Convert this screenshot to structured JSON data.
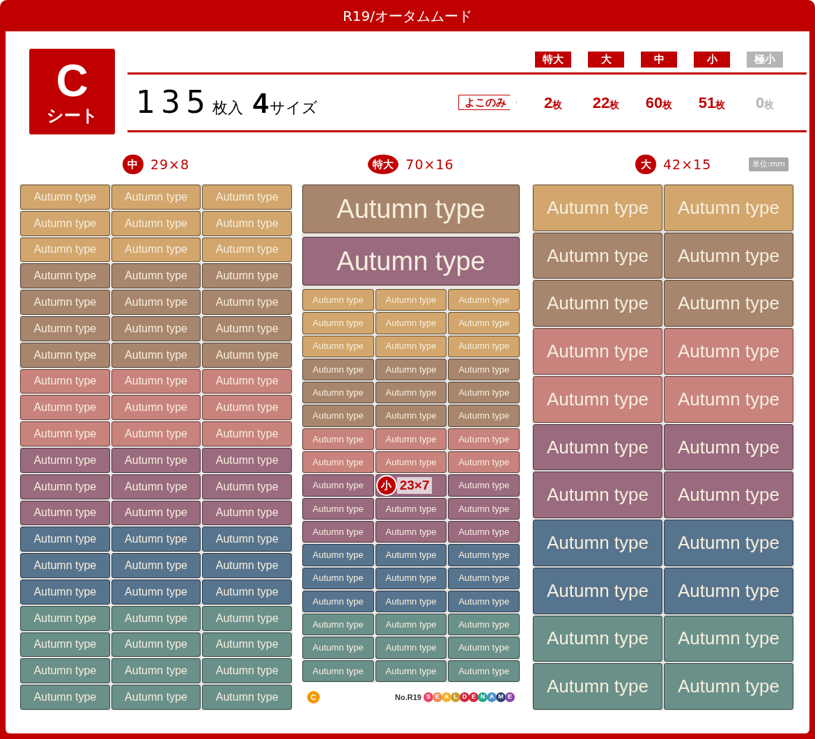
{
  "title": "R19/オータムムード",
  "sheet_badge": {
    "letter": "C",
    "label": "シート"
  },
  "summary": {
    "count": "135",
    "count_unit": "枚入",
    "sizes": "4",
    "sizes_unit": "サイズ"
  },
  "size_table": {
    "tag": "よこのみ",
    "sizes": [
      {
        "label": "特大",
        "count": "2",
        "unit": "枚",
        "disabled": false
      },
      {
        "label": "大",
        "count": "22",
        "unit": "枚",
        "disabled": false
      },
      {
        "label": "中",
        "count": "60",
        "unit": "枚",
        "disabled": false
      },
      {
        "label": "小",
        "count": "51",
        "unit": "枚",
        "disabled": false
      },
      {
        "label": "極小",
        "count": "0",
        "unit": "枚",
        "disabled": true
      }
    ]
  },
  "unit_note": "単位:mm",
  "columns": [
    {
      "badge": "中",
      "dimensions": "29×8",
      "rows": [
        {
          "color": "#d2a66d",
          "cells": [
            "Autumn type",
            "Autumn type",
            "Autumn type"
          ]
        },
        {
          "color": "#d2a66d",
          "cells": [
            "Autumn type",
            "Autumn type",
            "Autumn type"
          ]
        },
        {
          "color": "#d2a66d",
          "cells": [
            "Autumn type",
            "Autumn type",
            "Autumn type"
          ]
        },
        {
          "color": "#a8866d",
          "cells": [
            "Autumn type",
            "Autumn type",
            "Autumn type"
          ]
        },
        {
          "color": "#a8866d",
          "cells": [
            "Autumn type",
            "Autumn type",
            "Autumn type"
          ]
        },
        {
          "color": "#a8866d",
          "cells": [
            "Autumn type",
            "Autumn type",
            "Autumn type"
          ]
        },
        {
          "color": "#a8866d",
          "cells": [
            "Autumn type",
            "Autumn type",
            "Autumn type"
          ]
        },
        {
          "color": "#c9837d",
          "cells": [
            "Autumn type",
            "Autumn type",
            "Autumn type"
          ]
        },
        {
          "color": "#c9837d",
          "cells": [
            "Autumn type",
            "Autumn type",
            "Autumn type"
          ]
        },
        {
          "color": "#c9837d",
          "cells": [
            "Autumn type",
            "Autumn type",
            "Autumn type"
          ]
        },
        {
          "color": "#9a6a7f",
          "cells": [
            "Autumn type",
            "Autumn type",
            "Autumn type"
          ]
        },
        {
          "color": "#9a6a7f",
          "cells": [
            "Autumn type",
            "Autumn type",
            "Autumn type"
          ]
        },
        {
          "color": "#9a6a7f",
          "cells": [
            "Autumn type",
            "Autumn type",
            "Autumn type"
          ]
        },
        {
          "color": "#57748e",
          "cells": [
            "Autumn type",
            "Autumn type",
            "Autumn type"
          ]
        },
        {
          "color": "#57748e",
          "cells": [
            "Autumn type",
            "Autumn type",
            "Autumn type"
          ]
        },
        {
          "color": "#57748e",
          "cells": [
            "Autumn type",
            "Autumn type",
            "Autumn type"
          ]
        },
        {
          "color": "#6a908a",
          "cells": [
            "Autumn type",
            "Autumn type",
            "Autumn type"
          ]
        },
        {
          "color": "#6a908a",
          "cells": [
            "Autumn type",
            "Autumn type",
            "Autumn type"
          ]
        },
        {
          "color": "#6a908a",
          "cells": [
            "Autumn type",
            "Autumn type",
            "Autumn type"
          ]
        },
        {
          "color": "#6a908a",
          "cells": [
            "Autumn type",
            "Autumn type",
            "Autumn type"
          ]
        }
      ]
    },
    {
      "badge": "特大",
      "dimensions": "70×16",
      "rows": [
        {
          "color": "#a8866d",
          "cells": [
            "Autumn type"
          ]
        },
        {
          "color": "#9a6a7f",
          "cells": [
            "Autumn type"
          ]
        },
        {
          "color": "#d2a66d",
          "cells": [
            "Autumn type",
            "Autumn type",
            "Autumn type"
          ]
        },
        {
          "color": "#d2a66d",
          "cells": [
            "Autumn type",
            "Autumn type",
            "Autumn type"
          ]
        },
        {
          "color": "#d2a66d",
          "cells": [
            "Autumn type",
            "Autumn type",
            "Autumn type"
          ]
        },
        {
          "color": "#a8866d",
          "cells": [
            "Autumn type",
            "Autumn type",
            "Autumn type"
          ]
        },
        {
          "color": "#a8866d",
          "cells": [
            "Autumn type",
            "Autumn type",
            "Autumn type"
          ]
        },
        {
          "color": "#a8866d",
          "cells": [
            "Autumn type",
            "Autumn type",
            "Autumn type"
          ]
        },
        {
          "color": "#c9837d",
          "cells": [
            "Autumn type",
            "Autumn type",
            "Autumn type"
          ]
        },
        {
          "color": "#c9837d",
          "cells": [
            "Autumn type",
            "Autumn type",
            "Autumn type"
          ]
        },
        {
          "color": "#9a6a7f",
          "cells": [
            "Autumn type",
            {
              "badge": "小",
              "dimensions": "23×7"
            },
            "Autumn type"
          ]
        },
        {
          "color": "#9a6a7f",
          "cells": [
            "Autumn type",
            "Autumn type",
            "Autumn type"
          ]
        },
        {
          "color": "#9a6a7f",
          "cells": [
            "Autumn type",
            "Autumn type",
            "Autumn type"
          ]
        },
        {
          "color": "#57748e",
          "cells": [
            "Autumn type",
            "Autumn type",
            "Autumn type"
          ]
        },
        {
          "color": "#57748e",
          "cells": [
            "Autumn type",
            "Autumn type",
            "Autumn type"
          ]
        },
        {
          "color": "#57748e",
          "cells": [
            "Autumn type",
            "Autumn type",
            "Autumn type"
          ]
        },
        {
          "color": "#6a908a",
          "cells": [
            "Autumn type",
            "Autumn type",
            "Autumn type"
          ]
        },
        {
          "color": "#6a908a",
          "cells": [
            "Autumn type",
            "Autumn type",
            "Autumn type"
          ]
        },
        {
          "color": "#6a908a",
          "cells": [
            "Autumn type",
            "Autumn type",
            "Autumn type"
          ]
        }
      ],
      "footer": {
        "sheet_mark": "C",
        "product_no": "No.R19",
        "logo": [
          {
            "letter": "S",
            "color": "#e8436b"
          },
          {
            "letter": "E",
            "color": "#f0895a"
          },
          {
            "letter": "A",
            "color": "#f2b42a"
          },
          {
            "letter": "L",
            "color": "#c89d2a"
          },
          {
            "letter": "D",
            "color": "#d3283a"
          },
          {
            "letter": "E",
            "color": "#d3283a"
          },
          {
            "letter": "N",
            "color": "#22a88a"
          },
          {
            "letter": "A",
            "color": "#4a92c9"
          },
          {
            "letter": "M",
            "color": "#2c3f7c"
          },
          {
            "letter": "E",
            "color": "#8e46ac"
          }
        ]
      }
    },
    {
      "badge": "大",
      "dimensions": "42×15",
      "rows": [
        {
          "color": "#d2a66d",
          "cells": [
            "Autumn type",
            "Autumn type"
          ]
        },
        {
          "color": "#a8866d",
          "cells": [
            "Autumn type",
            "Autumn type"
          ]
        },
        {
          "color": "#a8866d",
          "cells": [
            "Autumn type",
            "Autumn type"
          ]
        },
        {
          "color": "#c9837d",
          "cells": [
            "Autumn type",
            "Autumn type"
          ]
        },
        {
          "color": "#c9837d",
          "cells": [
            "Autumn type",
            "Autumn type"
          ]
        },
        {
          "color": "#9a6a7f",
          "cells": [
            "Autumn type",
            "Autumn type"
          ]
        },
        {
          "color": "#9a6a7f",
          "cells": [
            "Autumn type",
            "Autumn type"
          ]
        },
        {
          "color": "#57748e",
          "cells": [
            "Autumn type",
            "Autumn type"
          ]
        },
        {
          "color": "#57748e",
          "cells": [
            "Autumn type",
            "Autumn type"
          ]
        },
        {
          "color": "#6a908a",
          "cells": [
            "Autumn type",
            "Autumn type"
          ]
        },
        {
          "color": "#6a908a",
          "cells": [
            "Autumn type",
            "Autumn type"
          ]
        }
      ]
    }
  ]
}
